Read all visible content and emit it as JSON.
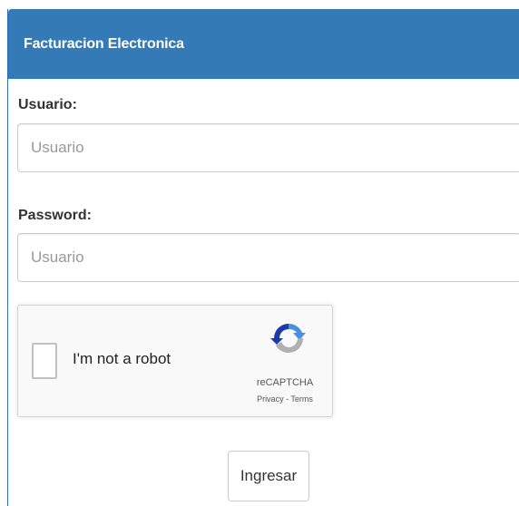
{
  "panel": {
    "title": "Facturacion Electronica"
  },
  "form": {
    "user_label": "Usuario:",
    "user_placeholder": "Usuario",
    "user_value": "",
    "password_label": "Password:",
    "password_placeholder": "Usuario",
    "password_value": "",
    "submit_label": "Ingresar"
  },
  "recaptcha": {
    "checkbox_label": "I'm not a robot",
    "brand": "reCAPTCHA",
    "privacy_link": "Privacy",
    "separator": " - ",
    "terms_link": "Terms",
    "logo_icon": "recaptcha-logo-icon",
    "checked": false
  },
  "colors": {
    "header_bg": "#337ab7",
    "header_text": "#ffffff",
    "input_border": "#cccccc",
    "recaptcha_bg": "#f9f9f9"
  }
}
